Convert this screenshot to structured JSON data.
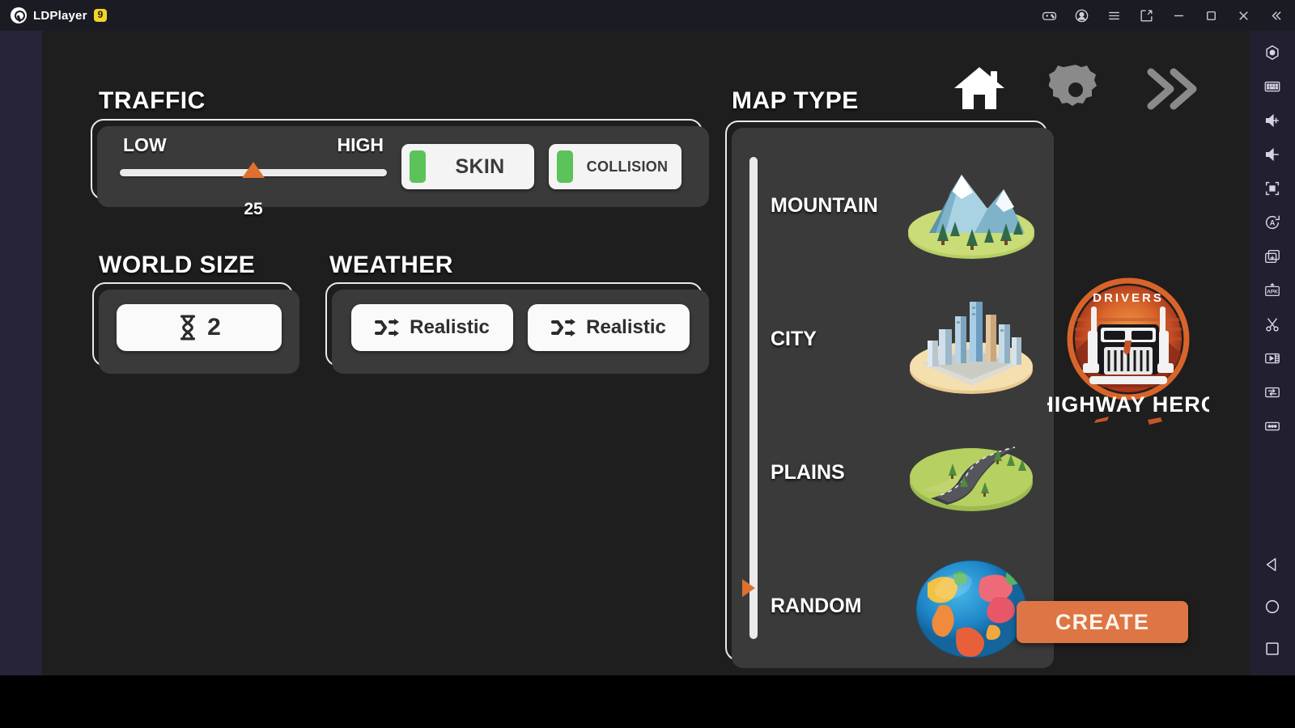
{
  "titlebar": {
    "app_name": "LDPlayer",
    "version_badge": "9",
    "controls": [
      {
        "name": "gamepad-icon",
        "label": "Gamepad"
      },
      {
        "name": "account-icon",
        "label": "Account"
      },
      {
        "name": "menu-icon",
        "label": "Menu"
      },
      {
        "name": "share-icon",
        "label": "Share"
      },
      {
        "name": "minimize-icon",
        "label": "Minimize"
      },
      {
        "name": "maximize-icon",
        "label": "Maximize"
      },
      {
        "name": "close-icon",
        "label": "Close"
      },
      {
        "name": "collapse-icon",
        "label": "Collapse"
      }
    ]
  },
  "sidebar": {
    "tools": [
      {
        "name": "record-icon",
        "label": "Record"
      },
      {
        "name": "keyboard-icon",
        "label": "Keyboard"
      },
      {
        "name": "volume-up-icon",
        "label": "Volume Up"
      },
      {
        "name": "volume-down-icon",
        "label": "Volume Down"
      },
      {
        "name": "fullscreen-icon",
        "label": "Fullscreen"
      },
      {
        "name": "auto-rotate-icon",
        "label": "Auto Rotate"
      },
      {
        "name": "multi-instance-icon",
        "label": "Multi Instance"
      },
      {
        "name": "apk-install-icon",
        "label": "APK"
      },
      {
        "name": "scissors-icon",
        "label": "Screenshot"
      },
      {
        "name": "video-icon",
        "label": "Video Recorder"
      },
      {
        "name": "file-transfer-icon",
        "label": "File Transfer"
      },
      {
        "name": "more-icon",
        "label": "More"
      }
    ],
    "nav": [
      {
        "name": "android-back-icon",
        "label": "Back"
      },
      {
        "name": "android-home-icon",
        "label": "Home"
      },
      {
        "name": "android-recents-icon",
        "label": "Recents"
      }
    ]
  },
  "game": {
    "traffic": {
      "title": "TRAFFIC",
      "slider": {
        "min_label": "LOW",
        "max_label": "HIGH",
        "value": "25",
        "percent": 50
      },
      "toggles": [
        {
          "label": "SKIN",
          "enabled": true,
          "led_color": "#5cc25a"
        },
        {
          "label": "COLLISION",
          "enabled": true,
          "led_color": "#5cc25a"
        }
      ]
    },
    "world_size": {
      "title": "WORLD SIZE",
      "value": "2",
      "icon": "hourglass-icon"
    },
    "weather": {
      "title": "WEATHER",
      "options": [
        {
          "label": "Realistic",
          "icon": "shuffle-icon"
        },
        {
          "label": "Realistic",
          "icon": "shuffle-icon"
        }
      ]
    },
    "map_type": {
      "title": "MAP TYPE",
      "selected": "RANDOM",
      "items": [
        {
          "label": "MOUNTAIN",
          "thumb": "mountain-thumb"
        },
        {
          "label": "CITY",
          "thumb": "city-thumb"
        },
        {
          "label": "PLAINS",
          "thumb": "plains-thumb"
        },
        {
          "label": "RANDOM",
          "thumb": "globe-thumb"
        }
      ]
    },
    "top_icons": [
      {
        "name": "home-icon",
        "label": "Home"
      },
      {
        "name": "gear-icon",
        "label": "Settings"
      },
      {
        "name": "fast-forward-icon",
        "label": "Next"
      }
    ],
    "logo": {
      "top_text": "DRIVERS",
      "bottom_text": "HIGHWAY HERO"
    },
    "create_button": "CREATE",
    "colors": {
      "accent_orange": "#e0702f",
      "create_orange": "#dd7545",
      "panel_gray": "#3a3a3a",
      "canvas": "#1e1e1e"
    }
  }
}
